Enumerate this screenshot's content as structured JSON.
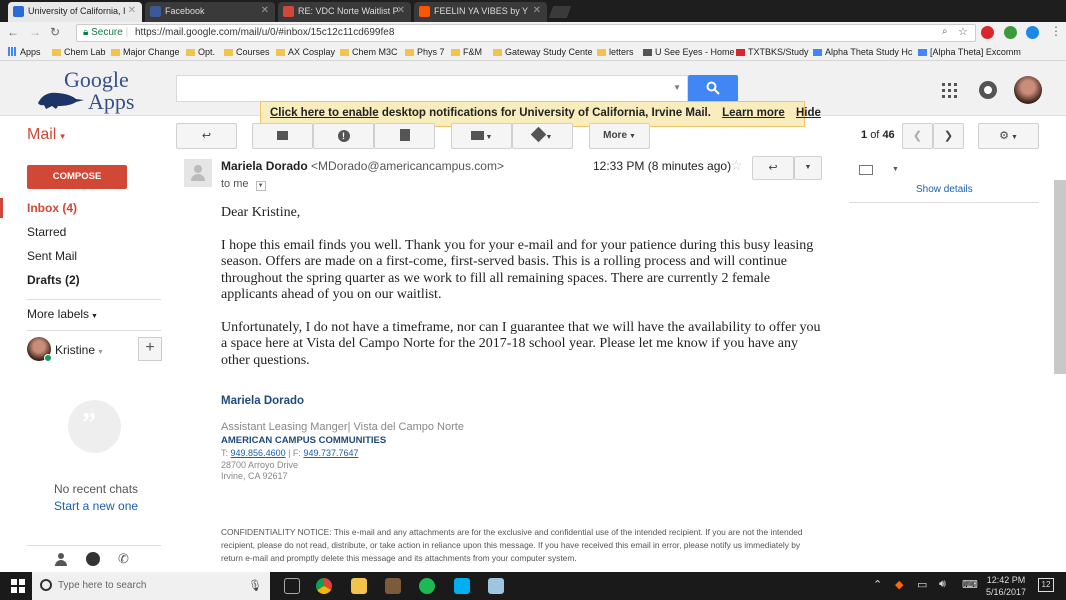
{
  "browser": {
    "tabs": [
      {
        "label": "University of California, I",
        "color": "#2a6bd8"
      },
      {
        "label": "Facebook",
        "color": "#3b5998"
      },
      {
        "label": "RE: VDC Norte Waitlist P",
        "color": "#d14836"
      },
      {
        "label": "FEELIN YA VIBES by Y",
        "color": "#ff5500"
      }
    ],
    "secure_label": "Secure",
    "url": "https://mail.google.com/mail/u/0/#inbox/15c12c11cd699fe8",
    "bookmarks": [
      "Apps",
      "Chem Lab",
      "Major Change",
      "Opt.",
      "Courses",
      "AX Cosplay",
      "Chem M3C",
      "Phys 7",
      "F&M",
      "Gateway Study Cente",
      "letters",
      "U See Eyes - Home",
      "TXTBKS/Study",
      "Alpha Theta Study Hc",
      "[Alpha Theta] Excomm"
    ]
  },
  "gmail": {
    "logo_word1": "Google",
    "logo_word2": "Apps",
    "notify": {
      "link": "Click here to enable",
      "text": " desktop notifications for University of California, Irvine Mail.",
      "learn_more": "Learn more",
      "hide": "Hide"
    },
    "mail_label": "Mail",
    "more_label": "More",
    "pager_start": "1",
    "pager_of": "of",
    "pager_total": "46",
    "compose": "COMPOSE",
    "nav": [
      "Inbox (4)",
      "Starred",
      "Sent Mail",
      "Drafts (2)"
    ],
    "more_labels": "More labels",
    "chat_user": "Kristine",
    "no_chats": "No recent chats",
    "start_new": "Start a new one",
    "show_details": "Show details"
  },
  "message": {
    "sender_name": "Mariela Dorado",
    "sender_email": "<MDorado@americancampus.com>",
    "time": "12:33 PM (8 minutes ago)",
    "to": "to me",
    "greeting": "Dear Kristine,",
    "para1": "I hope this email finds you well. Thank you for your e-mail and for your patience during this busy leasing season. Offers are made on a first-come, first-served basis. This is a rolling process and will continue throughout the spring quarter as we work to fill all remaining spaces. There are currently 2 female applicants ahead of you on our waitlist.",
    "para2": "Unfortunately, I do not have a timeframe, nor can I guarantee that we will have the availability to offer you a space here at Vista del Campo Norte for the 2017-18 school year. Please let me know if you have any other questions.",
    "sig_name": "Mariela Dorado",
    "sig_title": "Assistant Leasing Manger| Vista del Campo Norte",
    "sig_company": "AMERICAN CAMPUS COMMUNITIES",
    "sig_t": "T:",
    "sig_phone": "949.856.4600",
    "sig_sep": " | F: ",
    "sig_fax": "949.737.7647",
    "sig_addr1": "28700 Arroyo Drive",
    "sig_addr2": "Irvine, CA 92617",
    "confidentiality": "CONFIDENTIALITY NOTICE: This e-mail and any attachments are for the exclusive and confidential use of the intended recipient. If you are not the intended recipient, please do not read, distribute, or take action in reliance upon this message. If you have received this email in error, please notify us immediately by return e-mail and promptly delete this message and its attachments from your computer system."
  },
  "taskbar": {
    "search_placeholder": "Type here to search",
    "time": "12:42 PM",
    "date": "5/16/2017",
    "notif_count": "12"
  }
}
